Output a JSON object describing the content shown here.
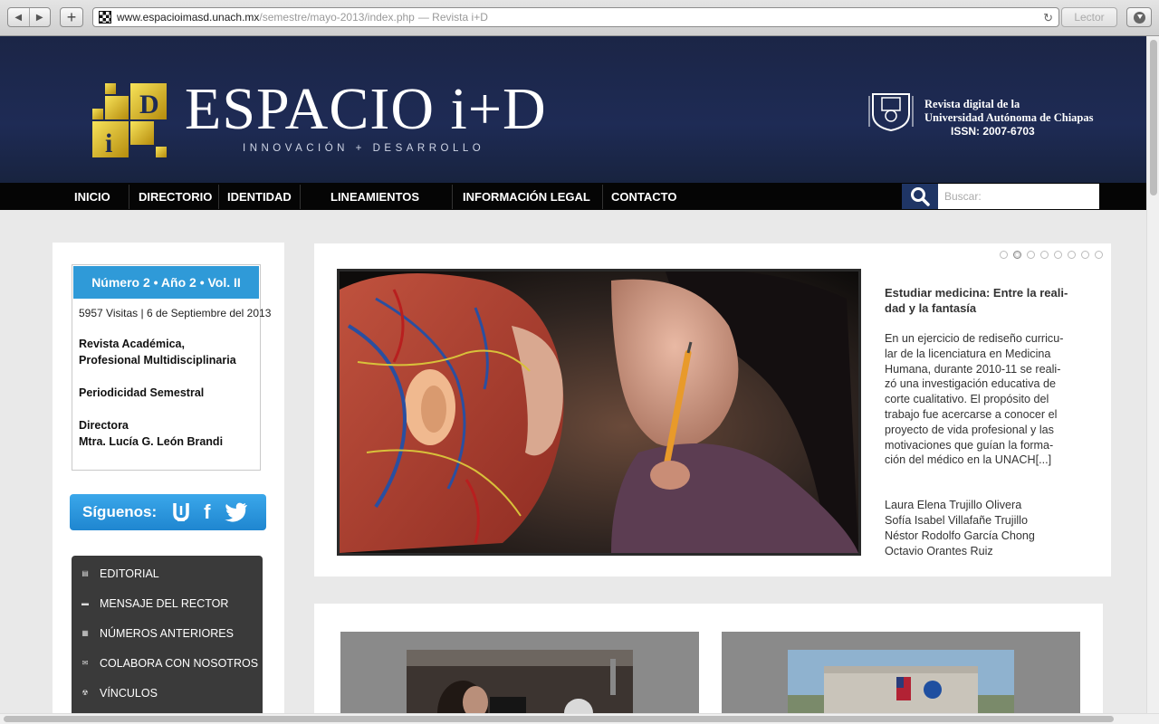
{
  "browser": {
    "url_host": "www.espacioimasd.unach.mx",
    "url_path": "/semestre/mayo-2013/index.php",
    "page_title": "— Revista i+D",
    "reader_label": "Lector",
    "icons": [
      "back-icon",
      "forward-icon",
      "add-tab-icon",
      "reload-icon",
      "download-icon"
    ]
  },
  "header": {
    "logo_text": "ESPACIO i+D",
    "tagline": "INNOVACIÓN + DESARROLLO",
    "university_line1": "Revista digital de la",
    "university_line2": "Universidad Autónoma de Chiapas",
    "issn": "ISSN: 2007-6703",
    "accent": "#e6c21a",
    "background": "#1e2b55"
  },
  "nav": {
    "items": [
      "INICIO",
      "DIRECTORIO",
      "IDENTIDAD",
      "LINEAMIENTOS",
      "INFORMACIÓN LEGAL",
      "CONTACTO"
    ],
    "search_placeholder": "Buscar:"
  },
  "sidebar": {
    "issue_title": "Número 2 • Año 2 • Vol. II",
    "visits": "5957 Visitas | 6 de Septiembre del 2013",
    "type_line1": "Revista Académica,",
    "type_line2": "Profesional Multidisciplinaria",
    "periodicity": "Periodicidad Semestral",
    "director_label": "Directora",
    "director_name": "Mtra. Lucía G. León Brandi",
    "follow_label": "Síguenos:",
    "social_icons": [
      "unach-icon",
      "facebook-icon",
      "twitter-icon"
    ],
    "menu": [
      {
        "label": "EDITORIAL",
        "icon": "document-icon"
      },
      {
        "label": "MENSAJE DEL RECTOR",
        "icon": "speech-icon"
      },
      {
        "label": "NÚMEROS ANTERIORES",
        "icon": "pages-icon"
      },
      {
        "label": "COLABORA CON NOSOTROS",
        "icon": "mail-icon"
      },
      {
        "label": "VÍNCULOS",
        "icon": "link-icon"
      }
    ]
  },
  "feature": {
    "slides_count": 8,
    "active_slide": 2,
    "title_line1": "Estudiar medicina: Entre la reali-",
    "title_line2": "dad y la fantasía",
    "summary_lines": [
      "En un ejercicio de rediseño curricu-",
      "lar de la licenciatura en Medicina",
      "Humana, durante 2010-11 se reali-",
      "zó una investigación educativa de",
      "corte cualitativo. El propósito del",
      "trabajo fue acercarse a conocer el",
      "proyecto de vida profesional y las",
      "motivaciones que guían la forma-",
      "ción del médico en la UNACH[...]"
    ],
    "authors": [
      "Laura Elena Trujillo Olivera",
      "Sofía Isabel Villafañe Trujillo",
      "Néstor Rodolfo García Chong",
      "Octavio Orantes Ruiz"
    ]
  }
}
